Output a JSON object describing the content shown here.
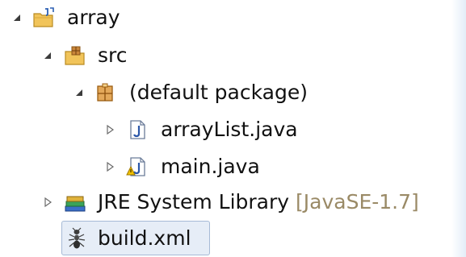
{
  "tree": {
    "project": {
      "label": "array",
      "icon": "java-project-icon",
      "expanded": true
    },
    "src_folder": {
      "label": "src",
      "icon": "source-folder-icon",
      "expanded": true
    },
    "package": {
      "label": "(default package)",
      "icon": "package-icon",
      "expanded": true
    },
    "files": [
      {
        "label": "arrayList.java",
        "icon": "java-file-icon",
        "expanded": false
      },
      {
        "label": "main.java",
        "icon": "java-file-warning-icon",
        "expanded": false
      }
    ],
    "library": {
      "label": "JRE System Library",
      "decoration": "[JavaSE-1.7]",
      "icon": "library-icon",
      "expanded": false
    },
    "build": {
      "label": "build.xml",
      "icon": "ant-file-icon",
      "selected": true
    }
  }
}
